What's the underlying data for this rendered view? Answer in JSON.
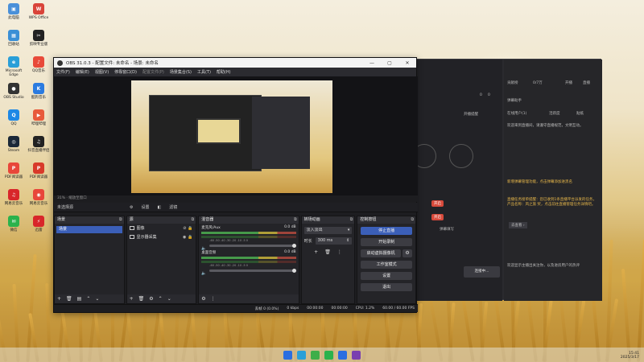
{
  "desktop": {
    "icons": [
      {
        "label": "此电脑",
        "color": "#4a90d9",
        "glyph": "▣"
      },
      {
        "label": "WPS Office",
        "color": "#d9443a",
        "glyph": "W"
      },
      {
        "label": "回收站",
        "color": "#3a8fd6",
        "glyph": "▦"
      },
      {
        "label": "剪映专业版",
        "color": "#222222",
        "glyph": "✂"
      },
      {
        "label": "Microsoft Edge",
        "color": "#2a9fd8",
        "glyph": "e"
      },
      {
        "label": "QQ音乐",
        "color": "#e84a3a",
        "glyph": "♪"
      },
      {
        "label": "OBS Studio",
        "color": "#333333",
        "glyph": "●"
      },
      {
        "label": "酷狗音乐",
        "color": "#2b7be0",
        "glyph": "K"
      },
      {
        "label": "QQ",
        "color": "#1e88e5",
        "glyph": "Q"
      },
      {
        "label": "哔哩哔哩",
        "color": "#e85a3a",
        "glyph": "▶"
      },
      {
        "label": "Steam",
        "color": "#1b2838",
        "glyph": "◎"
      },
      {
        "label": "抖音直播伴侣",
        "color": "#222222",
        "glyph": "♫"
      },
      {
        "label": "PDF阅读器",
        "color": "#e8463a",
        "glyph": "P"
      },
      {
        "label": "PDF阅读器",
        "color": "#d83a2a",
        "glyph": "P"
      },
      {
        "label": "网易云音乐",
        "color": "#d8262a",
        "glyph": "♫"
      },
      {
        "label": "网易云音乐",
        "color": "#e8463a",
        "glyph": "◉"
      },
      {
        "label": "微信",
        "color": "#2bb24c",
        "glyph": "✉"
      },
      {
        "label": "迅雷",
        "color": "#d8262a",
        "glyph": "⚡"
      }
    ]
  },
  "obs": {
    "title": "OBS 31.0.3 - 配置文件: 未命名 - 场景: 未命名",
    "menu": [
      "文件(F)",
      "编辑(E)",
      "视图(V)",
      "停靠窗口(D)",
      "配置文件(P)",
      "场景集合(S)",
      "工具(T)",
      "帮助(H)"
    ],
    "zoom_label": "31%  ·  缩放至窗口",
    "no_source": "未选择源",
    "props_label": "设置",
    "filter_label": "滤镜",
    "docks": {
      "scenes": {
        "title": "场景",
        "items": [
          "场景"
        ]
      },
      "sources": {
        "title": "源",
        "items": [
          "图像",
          "显示器采集"
        ]
      },
      "mixer": {
        "title": "混音器",
        "channels": [
          {
            "name": "麦克风/Aux",
            "db": "0.0 dB",
            "scale": "-60 -50 -40 -30 -20 -10 -5 0"
          },
          {
            "name": "桌面音频",
            "db": "0.0 dB",
            "scale": "-60 -50 -40 -30 -20 -10 -5 0"
          }
        ]
      },
      "transitions": {
        "title": "转场动画",
        "type": "淡入淡出",
        "duration_label": "时长",
        "duration": "300 ms"
      },
      "controls": {
        "title": "控制按钮",
        "stop_stream": "停止直播",
        "start_record": "开始录制",
        "virtual_cam": "启动虚拟摄像机",
        "studio_mode": "工作室模式",
        "settings": "设置",
        "exit": "退出"
      }
    },
    "status": {
      "dropped": "丢帧 0 (0.0%)",
      "bitrate": "0 kbps",
      "rec_time": "00:00:00",
      "stream_time": "00:00:00",
      "cpu": "CPU: 1.2%",
      "fps": "60.00 / 60.00 FPS"
    }
  },
  "streamapp": {
    "toolbar": [
      "开播提醒",
      "贡献榜",
      "0/7万",
      "开播",
      "直播"
    ],
    "counts": [
      "0",
      "0"
    ],
    "tabs": [
      "在线用户(1)",
      "活跃度",
      "贴纸"
    ],
    "assistant_title": "弹幕助手",
    "messages": [
      "欢迎来到直播间，请遵守直播规范，文明互动。",
      "新增弹幕管理功能，点击弹幕添加进黑名",
      "直播任务接单提醒：您已收到1条直播平台派发的任务，产品名称：风之旅 奖，点击前往直播管理任务详情吧。",
      "去查看 ›",
      "欢迎显示主播出关注你，以及进房用户的热评"
    ],
    "start_button": "连接中...",
    "side_label": "开启",
    "bottom_hint": "弹幕填写"
  },
  "taskbar": {
    "time": "15:41",
    "date": "2025/3/17",
    "icons": [
      "#2a6ee0",
      "#2a9fd8",
      "#3fae49",
      "#2bb24c",
      "#2a6ee0",
      "#7a3fb0"
    ]
  }
}
